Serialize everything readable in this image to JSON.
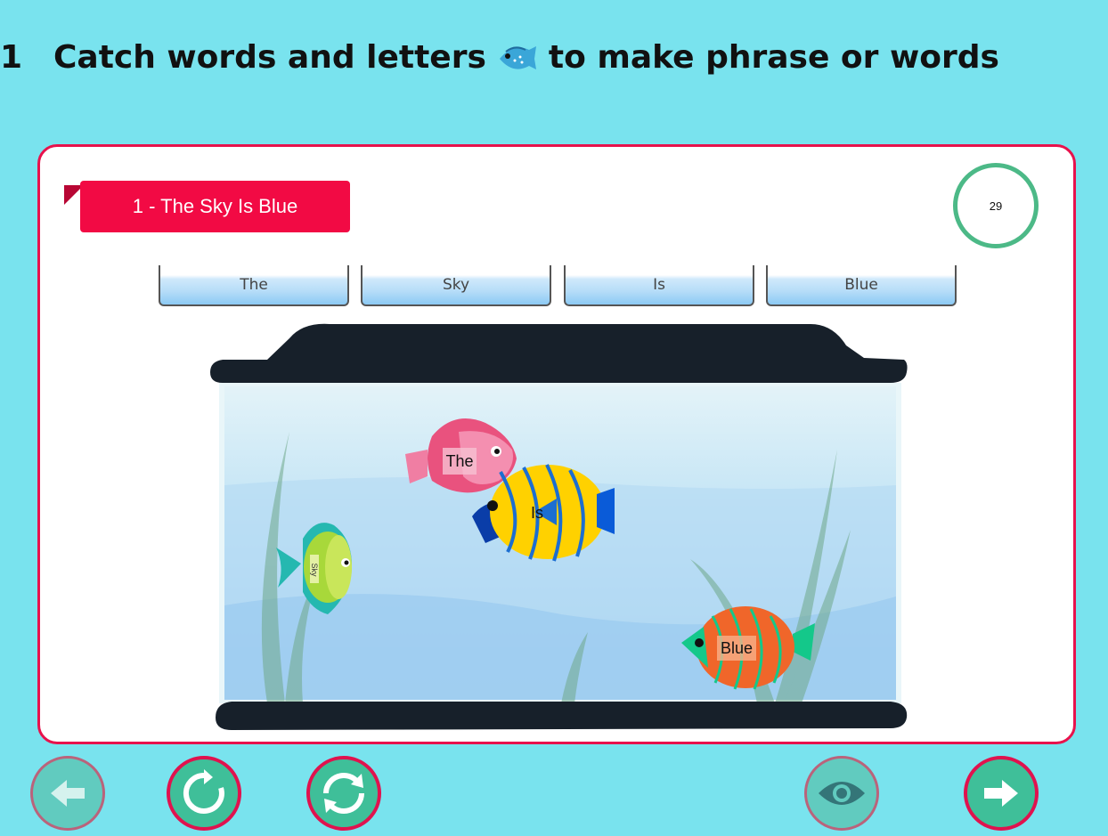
{
  "header": {
    "number": "1",
    "instruction_before": "Catch words and letters",
    "instruction_after": "to make phrase or words"
  },
  "game": {
    "title": "1 - The Sky Is Blue",
    "timer": "29",
    "slots": [
      "The",
      "Sky",
      "Is",
      "Blue"
    ],
    "fish": [
      {
        "label": "The",
        "color": "#f07ea3"
      },
      {
        "label": "Sky",
        "color": "#a8d83a"
      },
      {
        "label": "Is",
        "color": "#ffd100"
      },
      {
        "label": "Blue",
        "color": "#f0662a"
      }
    ]
  },
  "controls": {
    "back": "back-arrow-icon",
    "retry": "retry-icon",
    "restart": "restart-icon",
    "reveal": "eye-icon",
    "next": "next-arrow-icon"
  },
  "colors": {
    "background": "#79e3ee",
    "accent": "#f20a44",
    "timer_ring": "#4cb987",
    "button": "#3fbf99"
  }
}
